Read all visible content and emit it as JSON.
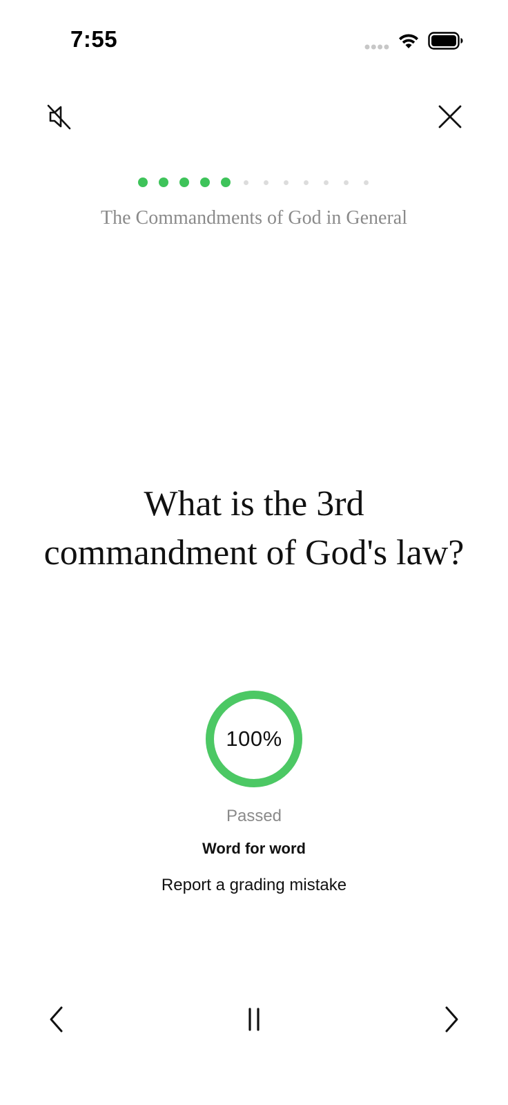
{
  "status_bar": {
    "time": "7:55",
    "icons": [
      "signal-icon",
      "wifi-icon",
      "battery-icon"
    ]
  },
  "header": {
    "mute_icon": "speaker-muted-icon",
    "close_icon": "close-icon"
  },
  "progress": {
    "completed": 5,
    "total": 12,
    "accent_color": "#3ec35a",
    "inactive_color": "#dcdcdc"
  },
  "section": {
    "title": "The Commandments of God in General"
  },
  "card": {
    "question": "What is the 3rd commandment of God's law?"
  },
  "result": {
    "score_text": "100%",
    "score_fraction": 1.0,
    "ring_color": "#4cc864",
    "status": "Passed",
    "mode": "Word for word",
    "report_link": "Report a grading mistake"
  },
  "controls": {
    "prev_icon": "chevron-left-icon",
    "pause_icon": "pause-icon",
    "next_icon": "chevron-right-icon"
  }
}
